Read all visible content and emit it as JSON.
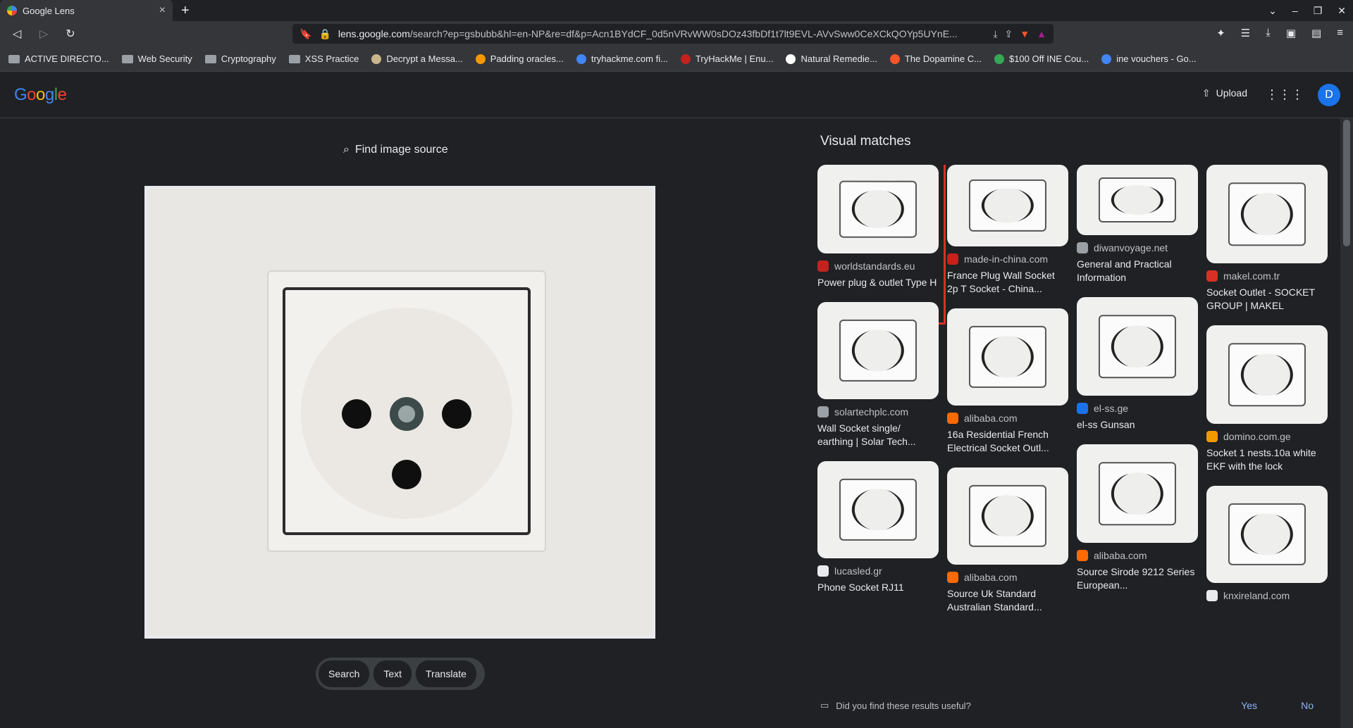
{
  "browser": {
    "tab_title": "Google Lens",
    "url_host": "lens.google.com",
    "url_rest": "/search?ep=gsbubb&hl=en-NP&re=df&p=Acn1BYdCF_0d5nVRvWW0sDOz43fbDf1t7lt9EVL-AVvSww0CeXCkQOYp5UYnE...",
    "bookmarks": [
      {
        "label": "ACTIVE DIRECTO...",
        "icon": "folder-icon",
        "color": "#9aa0a6"
      },
      {
        "label": "Web Security",
        "icon": "folder-icon",
        "color": "#9aa0a6"
      },
      {
        "label": "Cryptography",
        "icon": "folder-icon",
        "color": "#9aa0a6"
      },
      {
        "label": "XSS Practice",
        "icon": "folder-icon",
        "color": "#9aa0a6"
      },
      {
        "label": "Decrypt a Messa...",
        "icon": "page-icon",
        "color": "#c9b58a"
      },
      {
        "label": "Padding oracles...",
        "icon": "orange-icon",
        "color": "#f29900"
      },
      {
        "label": "tryhackme.com fi...",
        "icon": "google-icon",
        "color": "#4285f4"
      },
      {
        "label": "TryHackMe | Enu...",
        "icon": "thm-icon",
        "color": "#c5221f"
      },
      {
        "label": "Natural Remedie...",
        "icon": "n-icon",
        "color": "#ffffff"
      },
      {
        "label": "The Dopamine C...",
        "icon": "brave-icon",
        "color": "#fb542b"
      },
      {
        "label": "$100 Off INE Cou...",
        "icon": "bolt-icon",
        "color": "#34a853"
      },
      {
        "label": "ine vouchers - Go...",
        "icon": "google-icon",
        "color": "#4285f4"
      }
    ]
  },
  "lens": {
    "logo": "Google",
    "upload_label": "Upload",
    "avatar_letter": "D",
    "find_source": "Find image source",
    "actions": [
      "Search",
      "Text",
      "Translate"
    ],
    "visual_matches_title": "Visual matches",
    "feedback_question": "Did you find these results useful?",
    "feedback_yes": "Yes",
    "feedback_no": "No"
  },
  "results": {
    "columns": [
      [
        {
          "source": "worldstandards.eu",
          "title": "Power plug & outlet Type H",
          "thumb_h": 126,
          "color": "#c5221f",
          "highlighted": true
        },
        {
          "source": "solartechplc.com",
          "title": "Wall Socket single/ earthing | Solar Tech...",
          "thumb_h": 138,
          "color": "#9aa0a6",
          "highlighted": false
        },
        {
          "source": "lucasled.gr",
          "title": "Phone Socket RJ11",
          "thumb_h": 138,
          "color": "#e8eaed",
          "highlighted": false
        }
      ],
      [
        {
          "source": "made-in-china.com",
          "title": "France Plug Wall Socket 2p T Socket - China...",
          "thumb_h": 116,
          "color": "#c5221f",
          "highlighted": false
        },
        {
          "source": "alibaba.com",
          "title": "16a Residential French Electrical Socket Outl...",
          "thumb_h": 138,
          "color": "#ff6a00",
          "highlighted": false
        },
        {
          "source": "alibaba.com",
          "title": "Source Uk Standard Australian Standard...",
          "thumb_h": 138,
          "color": "#ff6a00",
          "highlighted": false
        }
      ],
      [
        {
          "source": "diwanvoyage.net",
          "title": "General and Practical Information",
          "thumb_h": 100,
          "color": "#9aa0a6",
          "highlighted": false
        },
        {
          "source": "el-ss.ge",
          "title": "el-ss Gunsan",
          "thumb_h": 140,
          "color": "#1a73e8",
          "highlighted": false
        },
        {
          "source": "alibaba.com",
          "title": "Source Sirode 9212 Series European...",
          "thumb_h": 140,
          "color": "#ff6a00",
          "highlighted": false
        }
      ],
      [
        {
          "source": "makel.com.tr",
          "title": "Socket Outlet - SOCKET GROUP | MAKEL",
          "thumb_h": 140,
          "color": "#d93025",
          "highlighted": false
        },
        {
          "source": "domino.com.ge",
          "title": "Socket 1 nests.10a white EKF with the lock",
          "thumb_h": 140,
          "color": "#f29900",
          "highlighted": false
        },
        {
          "source": "knxireland.com",
          "title": "",
          "thumb_h": 138,
          "color": "#e8eaed",
          "highlighted": false
        }
      ]
    ]
  }
}
